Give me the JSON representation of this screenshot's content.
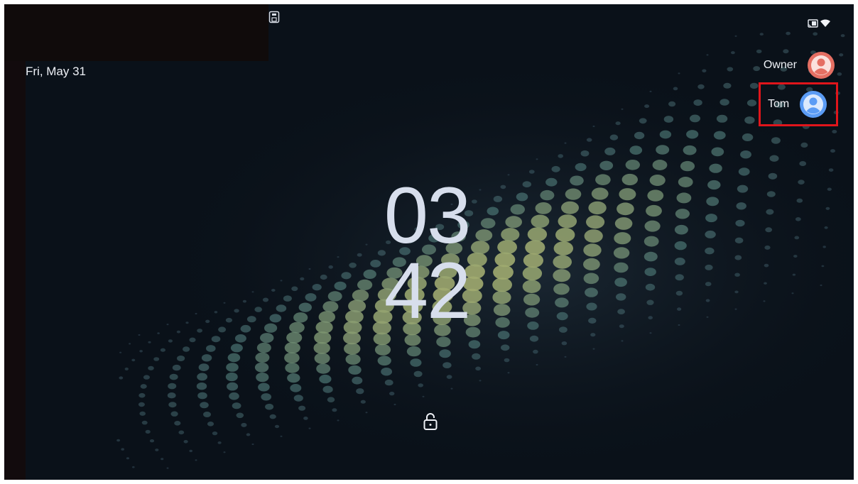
{
  "lockscreen": {
    "date": "Fri, May 31",
    "clock": {
      "hours": "03",
      "minutes": "42"
    }
  },
  "users": [
    {
      "name": "Owner",
      "avatar_icon": "person-avatar-icon",
      "avatar_color": "#e56f63"
    },
    {
      "name": "Tom",
      "avatar_icon": "person-avatar-icon",
      "avatar_color": "#5b9cf5"
    }
  ],
  "status_bar": {
    "icons": [
      "screen-record-icon",
      "cast-icon",
      "wifi-icon"
    ]
  },
  "colors": {
    "background": "#0a1119",
    "highlight": "#e0151b"
  }
}
